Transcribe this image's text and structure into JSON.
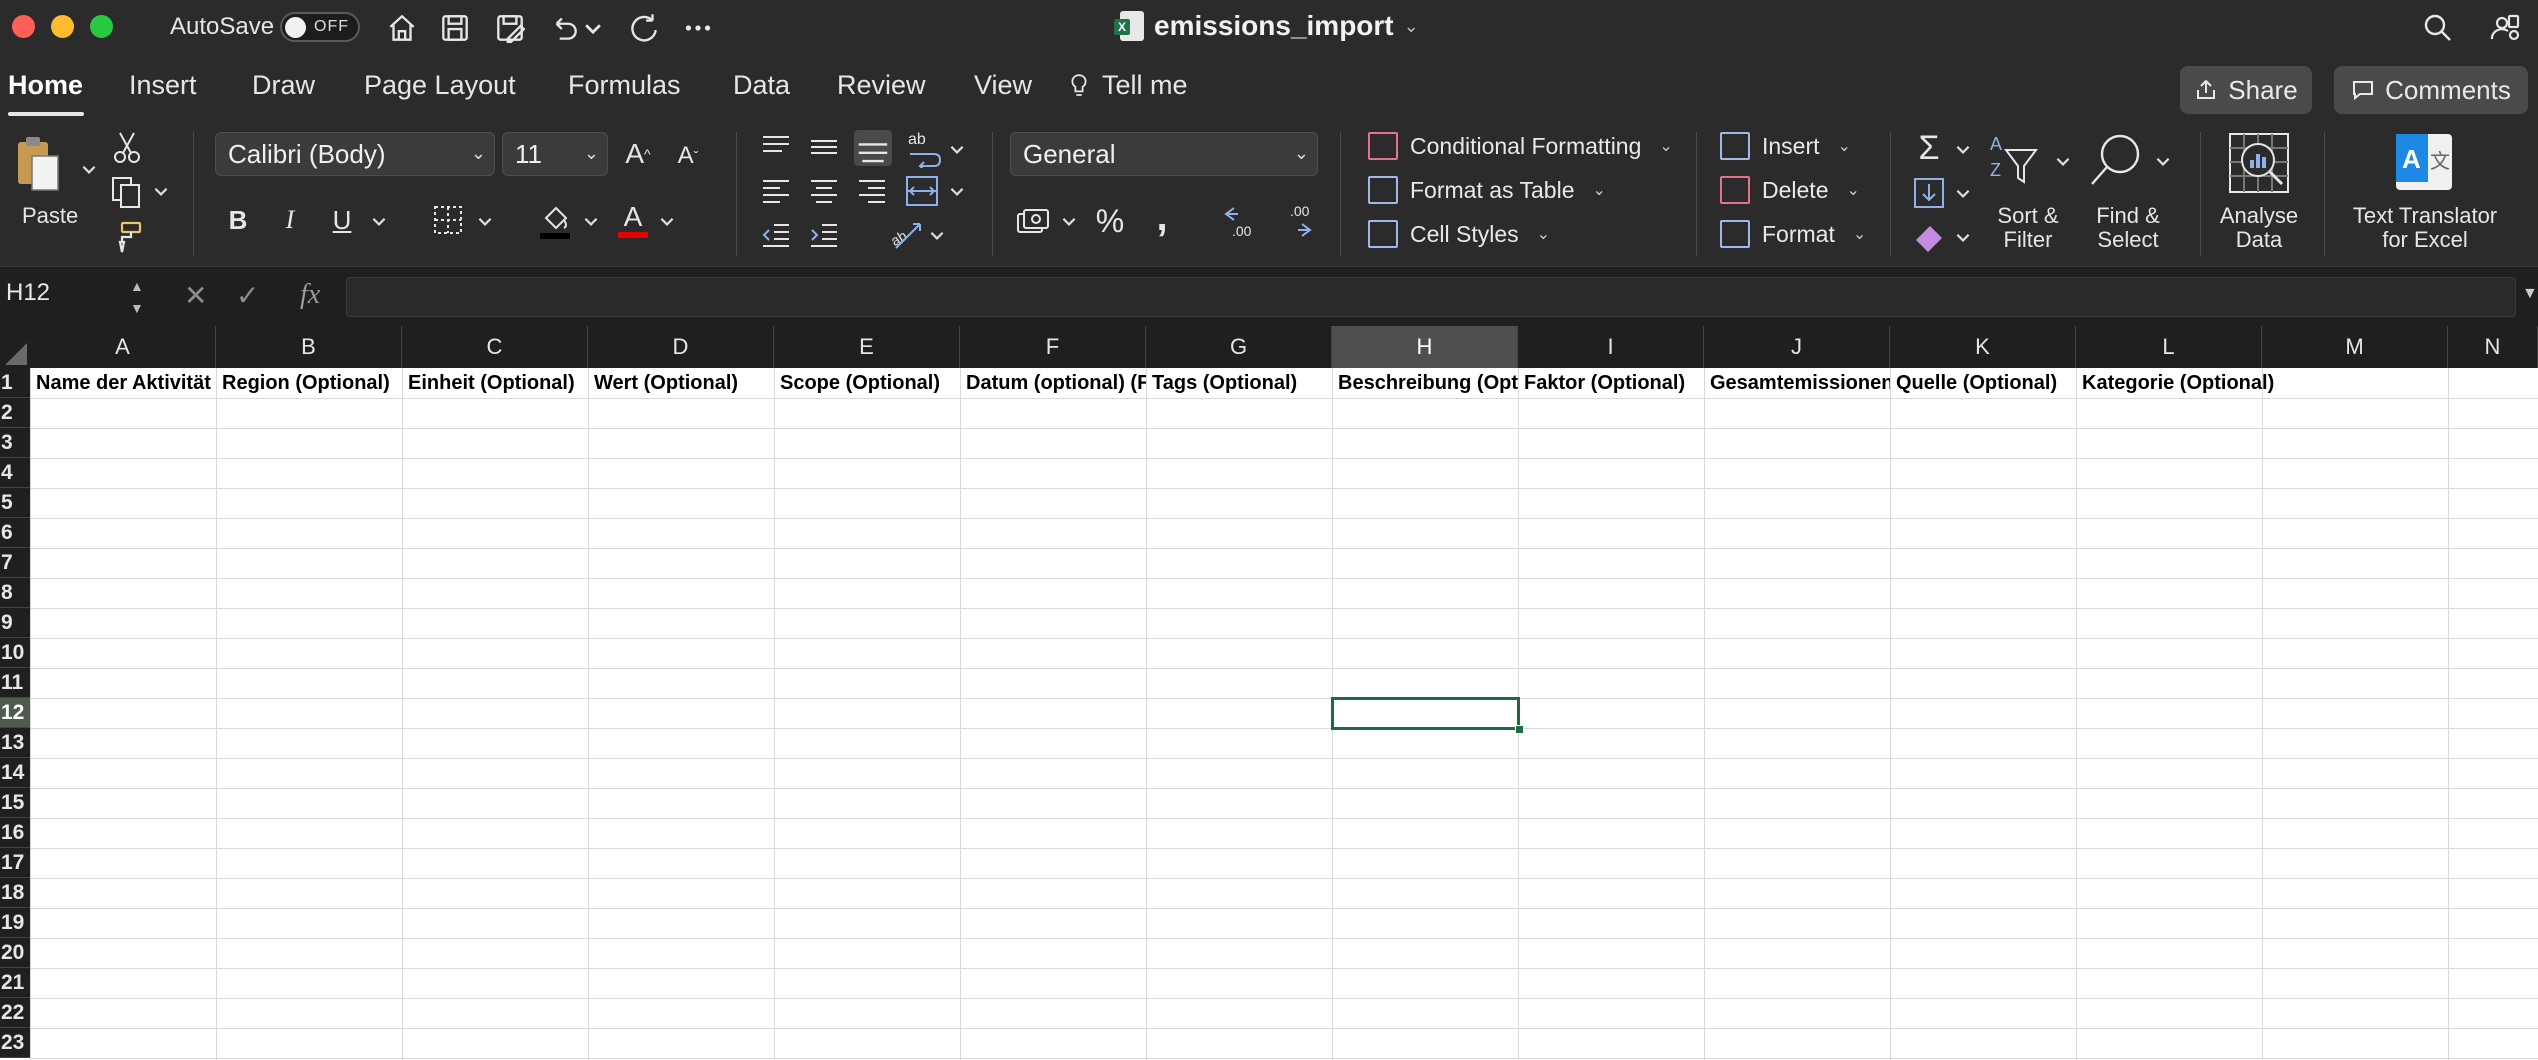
{
  "titlebar": {
    "autosave_label": "AutoSave",
    "autosave_state": "OFF",
    "doc_title": "emissions_import",
    "icons": [
      "home-icon",
      "save-icon",
      "save-as-icon",
      "undo-icon",
      "redo-icon",
      "more-icon",
      "search-icon",
      "account-icon"
    ]
  },
  "tabs": [
    "Home",
    "Insert",
    "Draw",
    "Page Layout",
    "Formulas",
    "Data",
    "Review",
    "View"
  ],
  "tell_me": "Tell me",
  "share_label": "Share",
  "comments_label": "Comments",
  "ribbon": {
    "paste_label": "Paste",
    "font_name": "Calibri (Body)",
    "font_size": "11",
    "number_format": "General",
    "conditional_formatting": "Conditional Formatting",
    "format_as_table": "Format as Table",
    "cell_styles": "Cell Styles",
    "insert": "Insert",
    "delete": "Delete",
    "format": "Format",
    "sort_filter_line1": "Sort &",
    "sort_filter_line2": "Filter",
    "find_select_line1": "Find &",
    "find_select_line2": "Select",
    "analyse_line1": "Analyse",
    "analyse_line2": "Data",
    "translator_line1": "Text Translator",
    "translator_line2": "for Excel",
    "bold": "B",
    "italic": "I",
    "underline": "U",
    "percent": "%",
    "comma": ","
  },
  "formula_bar": {
    "name_box": "H12",
    "fx": "fx",
    "formula": ""
  },
  "grid": {
    "columns": [
      "A",
      "B",
      "C",
      "D",
      "E",
      "F",
      "G",
      "H",
      "I",
      "J",
      "K",
      "L",
      "M",
      "N"
    ],
    "rows": [
      "1",
      "2",
      "3",
      "4",
      "5",
      "6",
      "7",
      "8",
      "9",
      "10",
      "11",
      "12",
      "13",
      "14",
      "15",
      "16",
      "17",
      "18",
      "19",
      "20",
      "21",
      "22",
      "23"
    ],
    "header_row": [
      "Name der Aktivität",
      "Region (Optional)",
      "Einheit (Optional)",
      "Wert (Optional)",
      "Scope (Optional)",
      "Datum (optional) (Format: YYYY-MM-DD)",
      "Tags (Optional)",
      "Beschreibung (Optional)",
      "Faktor (Optional)",
      "Gesamtemissionen",
      "Quelle (Optional)",
      "Kategorie (Optional)"
    ],
    "selected_cell": "H12",
    "selected_column": "H",
    "selected_row": "12"
  },
  "colors": {
    "chrome": "#2b2b2b",
    "accent_green": "#1e6b42",
    "header_bg": "#1f1f1f"
  }
}
